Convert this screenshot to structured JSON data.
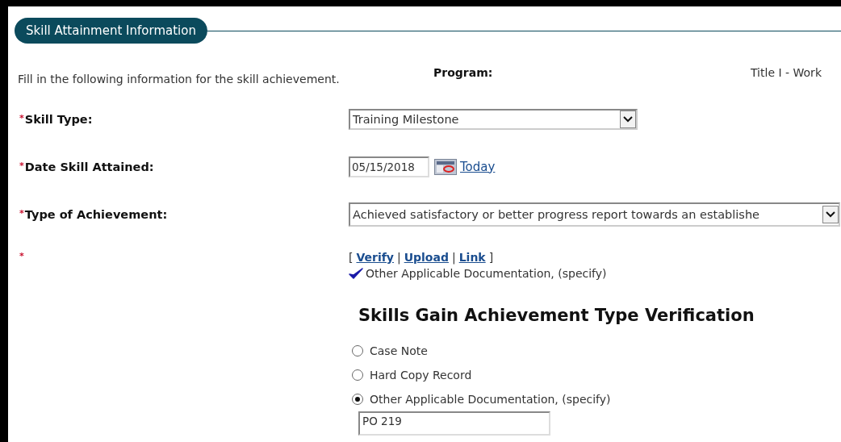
{
  "section": {
    "title": "Skill Attainment Information"
  },
  "intro": "Fill in the following information for the skill achievement.",
  "program": {
    "label": "Program:",
    "value": "Title I - Work"
  },
  "required_mark": "*",
  "fields": [
    {
      "kind": "select",
      "required": true,
      "label": "Skill Type:",
      "value": "Training Milestone"
    },
    {
      "kind": "date",
      "required": true,
      "label": "Date Skill Attained:",
      "value": "05/15/2018",
      "link": "Today"
    },
    {
      "kind": "select",
      "required": true,
      "label": "Type of Achievement:",
      "value": "Achieved satisfactory or better progress report towards an establishe",
      "wide": true
    },
    {
      "kind": "docs",
      "required": true,
      "open": "[",
      "separator": "|",
      "close": "]",
      "links": [
        "Verify",
        "Upload",
        "Link"
      ],
      "verified": "Other Applicable Documentation, (specify)"
    }
  ],
  "verification": {
    "title": "Skills Gain Achievement Type Verification",
    "options": [
      {
        "label": "Case Note",
        "selected": false
      },
      {
        "label": "Hard Copy Record",
        "selected": false
      },
      {
        "label": "Other Applicable Documentation, (specify)",
        "selected": true
      }
    ],
    "specify_value": "PO 219"
  }
}
